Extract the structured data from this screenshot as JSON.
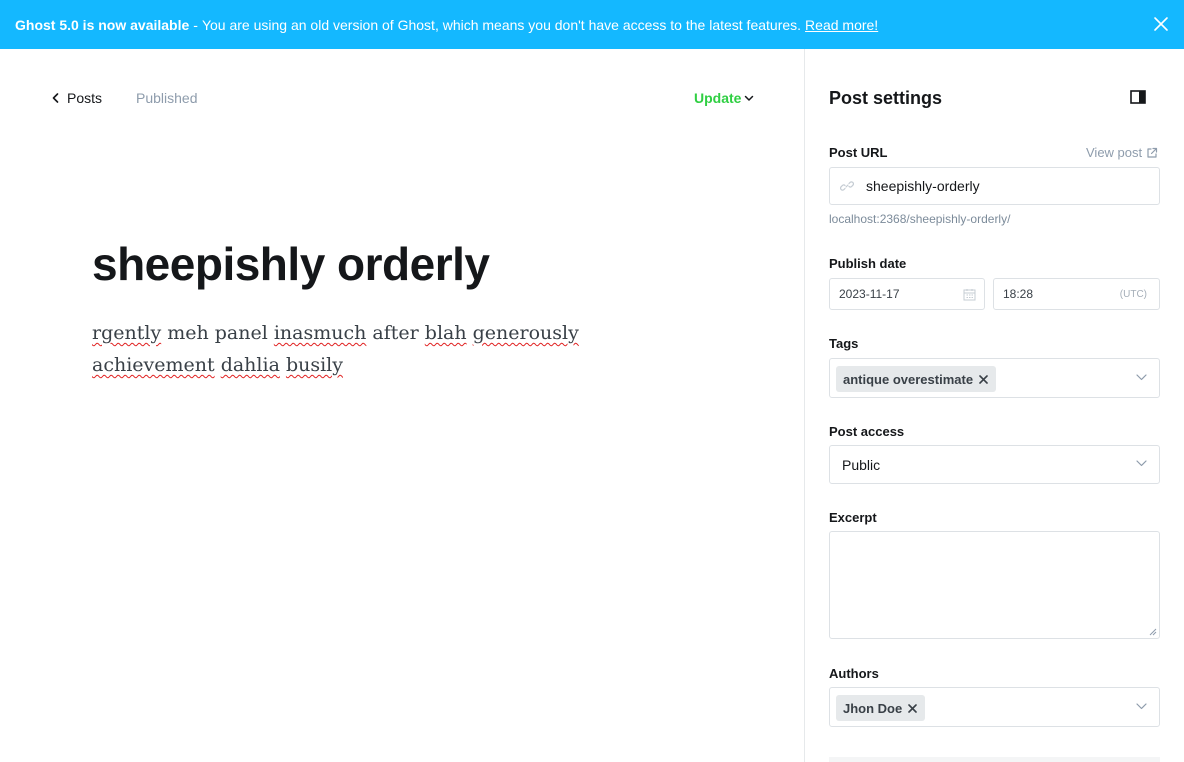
{
  "banner": {
    "strong": "Ghost 5.0 is now available",
    "separator": "-",
    "message": "You are using an old version of Ghost, which means you don't have access to the latest features.",
    "link": "Read more!",
    "icon": "close-icon"
  },
  "header": {
    "back_label": "Posts",
    "back_icon": "chevron-left-icon",
    "status": "Published",
    "update_label": "Update",
    "update_icon": "chevron-down-icon",
    "update_color": "#30cf43"
  },
  "post": {
    "title": "sheepishly orderly",
    "body": [
      {
        "text": "rgently",
        "spell": true
      },
      {
        "text": " meh panel ",
        "spell": false
      },
      {
        "text": "inasmuch",
        "spell": true
      },
      {
        "text": " after ",
        "spell": false
      },
      {
        "text": "blah",
        "spell": true
      },
      {
        "text": " ",
        "spell": false
      },
      {
        "text": "generously",
        "spell": true
      },
      {
        "text": " ",
        "spell": false
      },
      {
        "text": "achievement",
        "spell": true
      },
      {
        "text": " ",
        "spell": false
      },
      {
        "text": "dahlia",
        "spell": true
      },
      {
        "text": " ",
        "spell": false
      },
      {
        "text": "busily",
        "spell": true
      }
    ]
  },
  "settings": {
    "title": "Post settings",
    "toggle_icon": "sidebar-toggle-icon",
    "post_url": {
      "label": "Post URL",
      "view_post": "View post",
      "value": "sheepishly-orderly",
      "hint": "localhost:2368/sheepishly-orderly/",
      "icon": "link-icon"
    },
    "publish_date": {
      "label": "Publish date",
      "date": "2023-11-17",
      "time": "18:28",
      "timezone": "(UTC)",
      "icon": "calendar-icon"
    },
    "tags": {
      "label": "Tags",
      "items": [
        "antique overestimate"
      ]
    },
    "access": {
      "label": "Post access",
      "value": "Public"
    },
    "excerpt": {
      "label": "Excerpt",
      "value": ""
    },
    "authors": {
      "label": "Authors",
      "items": [
        "Jhon Doe"
      ]
    }
  },
  "colors": {
    "banner_bg": "#14b8ff",
    "accent_green": "#30cf43",
    "border": "#dde1e5"
  }
}
